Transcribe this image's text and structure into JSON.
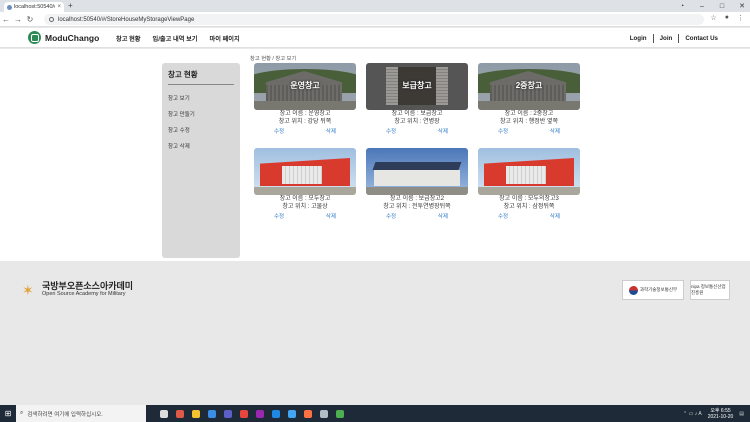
{
  "browser": {
    "tab_title": "localhost:50540/#/StoreHouseV",
    "url": "localhost:50540/#/StoreHouseMyStorageViewPage",
    "new_tab_symbol": "+",
    "close_symbol": "×"
  },
  "header": {
    "logo_text": "ModuChango",
    "nav": [
      "창고 현황",
      "입/출고 내역 보기",
      "마이 페이지"
    ],
    "right_nav": [
      "Login",
      "Join",
      "Contact Us"
    ]
  },
  "breadcrumb": "창고 현황 / 창고 보기",
  "sidebar": {
    "title": "창고 현황",
    "items": [
      "창고 보기",
      "창고 만들기",
      "창고 수정",
      "창고 삭제"
    ]
  },
  "cards": [
    {
      "overlay": "운영창고",
      "name": "창고 이름 : 운영창고",
      "location": "창고 위치 : 강당 뒤쪽",
      "edit": "수정",
      "delete": "삭제",
      "image": "barn"
    },
    {
      "overlay": "보급창고",
      "name": "창고 이름 : 보급창고",
      "location": "창고 위치 : 연병장",
      "edit": "수정",
      "delete": "삭제",
      "image": "unit"
    },
    {
      "overlay": "2중창고",
      "name": "창고 이름 : 2중창고",
      "location": "창고 위치 : 행정반 옆쪽",
      "edit": "수정",
      "delete": "삭제",
      "image": "barn"
    },
    {
      "overlay": "",
      "name": "창고 이름 : 모두창고",
      "location": "창고 위치 : 고물상",
      "edit": "수정",
      "delete": "삭제",
      "image": "red"
    },
    {
      "overlay": "",
      "name": "창고 이름 : 보급창고2",
      "location": "창고 위치 : 전투연병장뒤쪽",
      "edit": "수정",
      "delete": "삭제",
      "image": "solar"
    },
    {
      "overlay": "",
      "name": "창고 이름 : 모두의창고3",
      "location": "창고 위치 : 삼정뒤쪽",
      "edit": "수정",
      "delete": "삭제",
      "image": "red"
    }
  ],
  "footer": {
    "title": "국방부오픈소스아카데미",
    "subtitle": "Open Source Academy for Military",
    "partner1": "과학기술정보통신부",
    "partner2": "nipa 정보통신산업진흥원"
  },
  "taskbar": {
    "search_placeholder": "검색하려면 여기에 입력하십시오.",
    "time": "오후 6:55",
    "date": "2021-10-20"
  },
  "colors": {
    "accent_link": "#2a7ac7",
    "logo_green": "#2d8a57",
    "taskbar": "#1f2a38"
  }
}
